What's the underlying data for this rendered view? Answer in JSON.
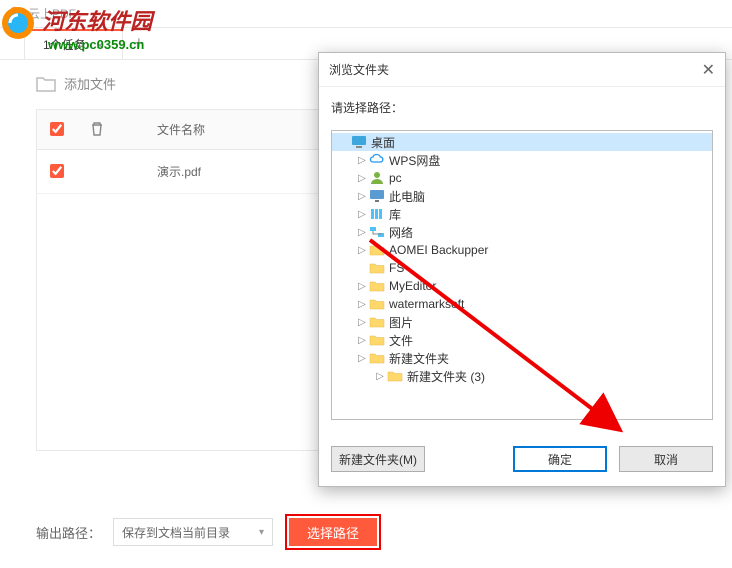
{
  "app": {
    "title": "云上PDF"
  },
  "watermark": {
    "line1_text": "河东软件园",
    "url": "www.pc0359.cn"
  },
  "tabs": {
    "active_label": "1个任务",
    "close": "×",
    "add": "+"
  },
  "toolbar": {
    "add_file": "添加文件"
  },
  "table": {
    "header": {
      "filename": "文件名称"
    },
    "rows": [
      {
        "name": "演示.pdf"
      }
    ]
  },
  "footer": {
    "output_label": "输出路径：",
    "select_value": "保存到文档当前目录",
    "choose_btn": "选择路径"
  },
  "dialog": {
    "title": "浏览文件夹",
    "instruction": "请选择路径：",
    "tree": [
      {
        "label": "桌面",
        "level": 0,
        "expander": "",
        "icon": "desktop",
        "selected": true
      },
      {
        "label": "WPS网盘",
        "level": 1,
        "expander": "▷",
        "icon": "cloud"
      },
      {
        "label": "pc",
        "level": 1,
        "expander": "▷",
        "icon": "user"
      },
      {
        "label": "此电脑",
        "level": 1,
        "expander": "▷",
        "icon": "pc"
      },
      {
        "label": "库",
        "level": 1,
        "expander": "▷",
        "icon": "lib"
      },
      {
        "label": "网络",
        "level": 1,
        "expander": "▷",
        "icon": "net"
      },
      {
        "label": "AOMEI Backupper",
        "level": 1,
        "expander": "▷",
        "icon": "folder"
      },
      {
        "label": "FS",
        "level": 1,
        "expander": "",
        "icon": "folder"
      },
      {
        "label": "MyEditor",
        "level": 1,
        "expander": "▷",
        "icon": "folder"
      },
      {
        "label": "watermarksoft",
        "level": 1,
        "expander": "▷",
        "icon": "folder"
      },
      {
        "label": "图片",
        "level": 1,
        "expander": "▷",
        "icon": "folder"
      },
      {
        "label": "文件",
        "level": 1,
        "expander": "▷",
        "icon": "folder"
      },
      {
        "label": "新建文件夹",
        "level": 1,
        "expander": "▷",
        "icon": "folder"
      },
      {
        "label": "新建文件夹 (3)",
        "level": 2,
        "expander": "▷",
        "icon": "folder"
      }
    ],
    "new_folder_btn": "新建文件夹(M)",
    "ok_btn": "确定",
    "cancel_btn": "取消"
  }
}
